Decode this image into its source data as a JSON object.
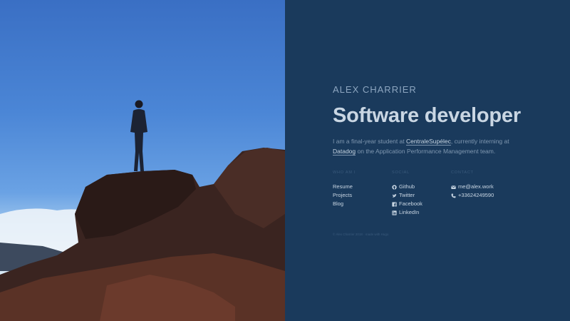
{
  "profile": {
    "name": "ALEX CHARRIER",
    "title": "Software developer",
    "bio": {
      "part1": "I am a final-year student at ",
      "link1": "CentraleSupélec",
      "part2": ", currently interning at ",
      "link2": "Datadog",
      "part3": " on the Application Performance Management team."
    }
  },
  "columns": [
    {
      "heading": "WHO AM I",
      "items": [
        {
          "label": "Resume"
        },
        {
          "label": "Projects"
        },
        {
          "label": "Blog"
        }
      ]
    },
    {
      "heading": "SOCIAL",
      "items": [
        {
          "label": "Github",
          "icon": "github-icon"
        },
        {
          "label": "Twitter",
          "icon": "twitter-icon"
        },
        {
          "label": "Facebook",
          "icon": "facebook-icon"
        },
        {
          "label": "LinkedIn",
          "icon": "linkedin-icon"
        }
      ]
    },
    {
      "heading": "CONTACT",
      "items": [
        {
          "label": "me@alex.work",
          "icon": "envelope-icon"
        },
        {
          "label": "+33624249590",
          "icon": "phone-icon"
        }
      ]
    }
  ],
  "footer": "© Alex Charrier 2018 · made with Hugo",
  "colors": {
    "panel_bg": "#1a3a5c",
    "text_primary": "#c9d6e3",
    "text_muted": "#7f97b0"
  }
}
